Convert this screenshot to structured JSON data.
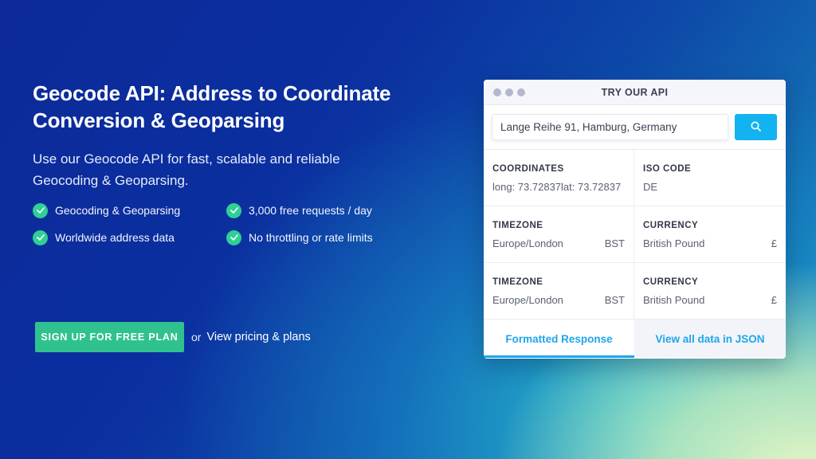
{
  "hero": {
    "title": "Geocode API: Address to Coordinate Conversion & Geoparsing",
    "lead": "Use our Geocode API for fast, scalable and reliable Geocoding & Geoparsing.",
    "features": [
      "Geocoding & Geoparsing",
      "3,000 free requests / day",
      "Worldwide address data",
      "No throttling or rate limits"
    ],
    "cta_label": "SIGN UP FOR FREE PLAN",
    "or_text": "or",
    "pricing_link": "View pricing & plans"
  },
  "panel": {
    "title": "TRY OUR API",
    "search_value": "Lange Reihe 91, Hamburg, Germany",
    "cells": [
      {
        "label": "COORDINATES",
        "value": "long: 73.72837lat: 73.72837",
        "extra": ""
      },
      {
        "label": "ISO CODE",
        "value": "DE",
        "extra": ""
      },
      {
        "label": "TIMEZONE",
        "value": "Europe/London",
        "extra": "BST"
      },
      {
        "label": "CURRENCY",
        "value": "British Pound",
        "extra": "£"
      },
      {
        "label": "TIMEZONE",
        "value": "Europe/London",
        "extra": "BST"
      },
      {
        "label": "CURRENCY",
        "value": "British Pound",
        "extra": "£"
      }
    ],
    "tab_formatted": "Formatted Response",
    "tab_json": "View all data in JSON"
  },
  "colors": {
    "accent_green": "#2fc28f",
    "accent_blue": "#12b3f0",
    "background_start": "#0c2a9a"
  },
  "icons": {
    "check": "check-icon",
    "search": "search-icon"
  }
}
